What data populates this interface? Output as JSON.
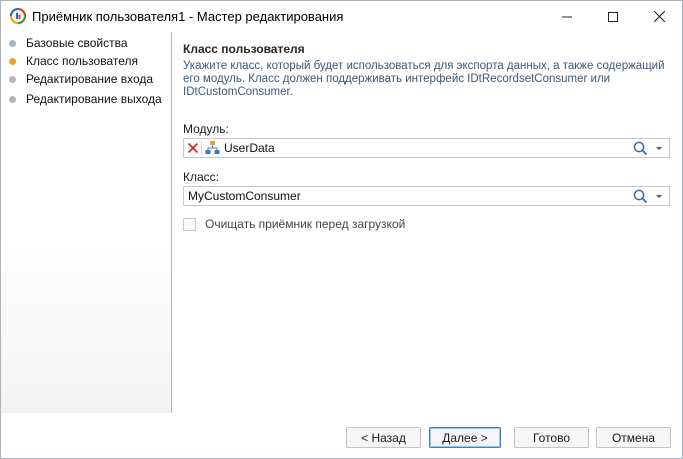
{
  "window": {
    "title": "Приёмник пользователя1 - Мастер редактирования"
  },
  "nav": {
    "items": [
      {
        "label": "Базовые свойства",
        "state": "done"
      },
      {
        "label": "Класс пользователя",
        "state": "active"
      },
      {
        "label": "Редактирование входа",
        "state": "pending"
      },
      {
        "label": "Редактирование выхода",
        "state": "pending"
      }
    ]
  },
  "main": {
    "title": "Класс пользователя",
    "description": "Укажите класс, который будет использоваться для экспорта данных, а также содержащий его модуль. Класс должен поддерживать интерфейс IDtRecordsetConsumer или IDtCustomConsumer.",
    "module_label": "Модуль:",
    "module_value": "UserData",
    "class_label": "Класс:",
    "class_value": "MyCustomConsumer",
    "clear_checkbox_label": "Очищать приёмник перед загрузкой",
    "clear_checkbox_checked": false
  },
  "buttons": {
    "back": "< Назад",
    "next": "Далее >",
    "done": "Готово",
    "cancel": "Отмена"
  },
  "colors": {
    "active_step": "#f0a030",
    "done_step": "#9eb8cf",
    "pending_step": "#b5b5b5",
    "description_text": "#3a5a78",
    "clear_icon": "#d42020"
  },
  "icons": [
    "app-logo-icon",
    "minimize-icon",
    "maximize-icon",
    "close-icon",
    "clear-x-icon",
    "module-hierarchy-icon",
    "search-icon",
    "chevron-down-icon"
  ]
}
